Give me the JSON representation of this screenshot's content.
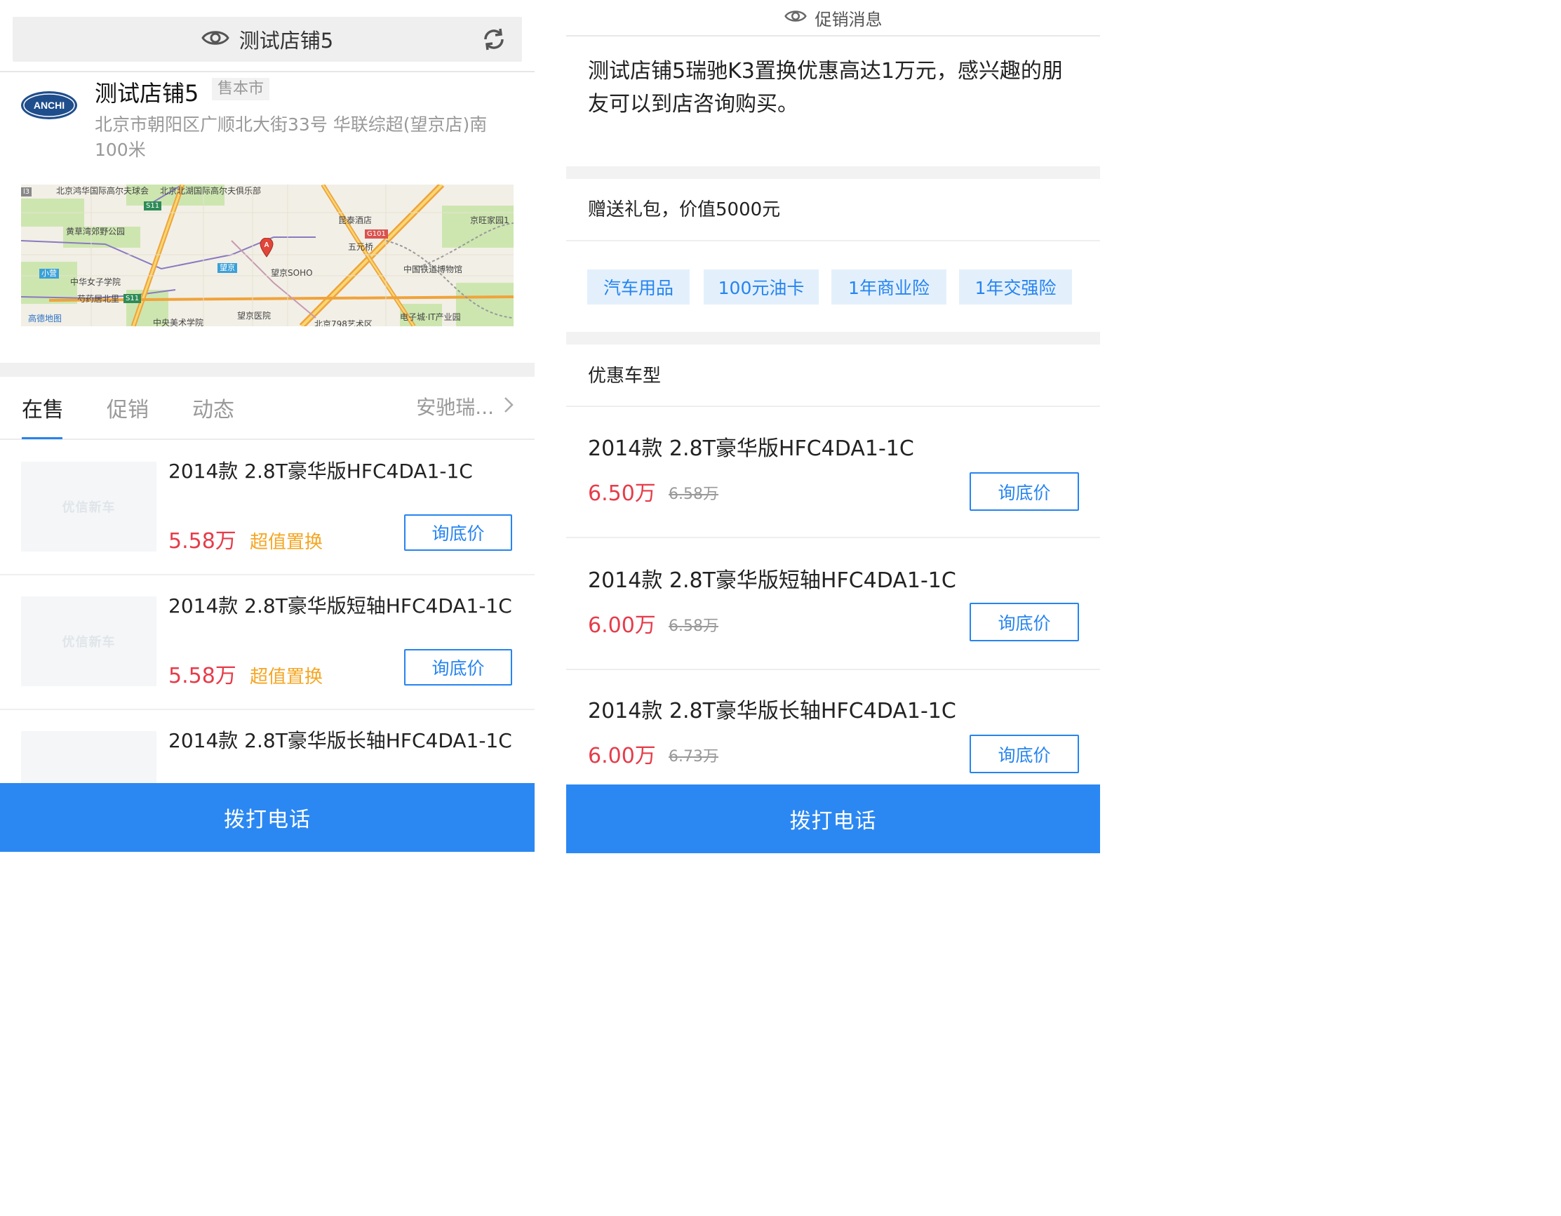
{
  "colors": {
    "accent": "#2684f0",
    "call_bar": "#2b88f2",
    "price": "#e63c4a",
    "promo": "#f5a623",
    "tag_bg": "#e3f0fc"
  },
  "left": {
    "header": {
      "title": "测试店铺5",
      "icon": "eye-icon",
      "refresh_icon": "refresh-icon"
    },
    "store": {
      "logo_text": "ANCHI",
      "name": "测试店铺5",
      "tag": "售本市",
      "address": "北京市朝阳区广顺北大街33号 华联综超(望京店)南100米"
    },
    "map": {
      "labels": [
        "北京鸿华国际高尔夫球会",
        "北京北湖国际高尔夫俱乐部",
        "黄草湾郊野公园",
        "昆泰酒店",
        "京旺家园1",
        "五元桥",
        "中国铁道博物馆",
        "望京",
        "望京SOHO",
        "小营",
        "中华女子学院",
        "芍药居北里",
        "望京医院",
        "中央美术学院",
        "北京798艺术区",
        "电子城·IT产业园",
        "高德地图"
      ],
      "badges": [
        "G101",
        "S11",
        "S11",
        "l3"
      ],
      "marker": "A"
    },
    "tabs": [
      {
        "label": "在售"
      },
      {
        "label": "促销"
      },
      {
        "label": "动态"
      }
    ],
    "tab_more": "安驰瑞...",
    "thumb_watermark": "优信新车",
    "cars": [
      {
        "title": "2014款 2.8T豪华版HFC4DA1-1C",
        "price": "5.58万",
        "promo": "超值置换",
        "button": "询底价"
      },
      {
        "title": "2014款 2.8T豪华版短轴HFC4DA1-1C",
        "price": "5.58万",
        "promo": "超值置换",
        "button": "询底价"
      },
      {
        "title": "2014款 2.8T豪华版长轴HFC4DA1-1C"
      }
    ],
    "call_button": "拨打电话"
  },
  "right": {
    "header": {
      "title": "促销消息",
      "icon": "eye-icon"
    },
    "promo_text": "测试店铺5瑞驰K3置换优惠高达1万元，感兴趣的朋友可以到店咨询购买。",
    "gift_title": "赠送礼包，价值5000元",
    "gift_tags": [
      "汽车用品",
      "100元油卡",
      "1年商业险",
      "1年交强险"
    ],
    "models_title": "优惠车型",
    "models": [
      {
        "title": "2014款 2.8T豪华版HFC4DA1-1C",
        "price": "6.50万",
        "orig_price": "6.58万",
        "button": "询底价"
      },
      {
        "title": "2014款 2.8T豪华版短轴HFC4DA1-1C",
        "price": "6.00万",
        "orig_price": "6.58万",
        "button": "询底价"
      },
      {
        "title": "2014款 2.8T豪华版长轴HFC4DA1-1C",
        "price": "6.00万",
        "orig_price": "6.73万",
        "button": "询底价"
      }
    ],
    "call_button": "拨打电话"
  }
}
